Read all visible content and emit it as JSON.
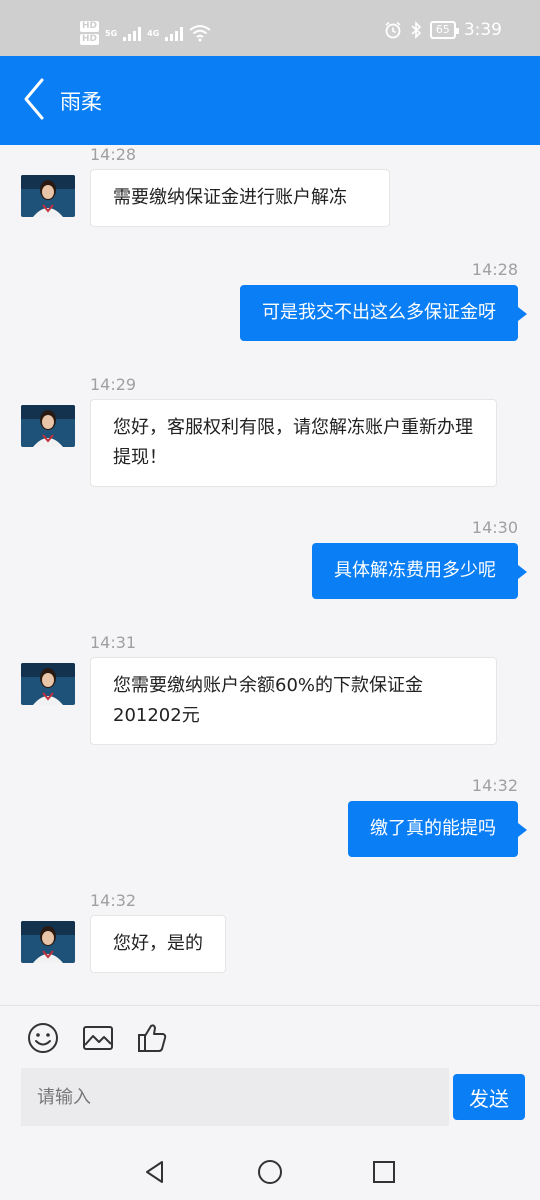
{
  "status_bar": {
    "hd_label": "HD",
    "net_label_1": "5G",
    "net_label_2": "4G",
    "battery": "65",
    "time": "3:39",
    "icons": [
      "alarm-icon",
      "bluetooth-icon",
      "battery-icon",
      "wifi-icon",
      "signal-icon"
    ]
  },
  "header": {
    "title": "雨柔",
    "back_icon": "chevron-left-icon",
    "background": "#0a7ef5"
  },
  "messages": [
    {
      "time": "14:28",
      "direction": "in",
      "text": "需要缴纳保证金进行账户解冻"
    },
    {
      "time": "14:28",
      "direction": "out",
      "text": "可是我交不出这么多保证金呀"
    },
    {
      "time": "14:29",
      "direction": "in",
      "text": "您好，客服权利有限，请您解冻账户重新办理提现！"
    },
    {
      "time": "14:30",
      "direction": "out",
      "text": "具体解冻费用多少呢"
    },
    {
      "time": "14:31",
      "direction": "in",
      "text": "您需要缴纳账户余额60%的下款保证金201202元"
    },
    {
      "time": "14:32",
      "direction": "out",
      "text": "缴了真的能提吗"
    },
    {
      "time": "14:32",
      "direction": "in",
      "text": "您好，是的"
    }
  ],
  "composer": {
    "icons": [
      "emoji-icon",
      "image-icon",
      "thumbs-up-icon"
    ],
    "placeholder": "请输入",
    "send_label": "发送"
  },
  "nav": {
    "icons": [
      "back-triangle-icon",
      "home-circle-icon",
      "recents-square-icon"
    ]
  }
}
